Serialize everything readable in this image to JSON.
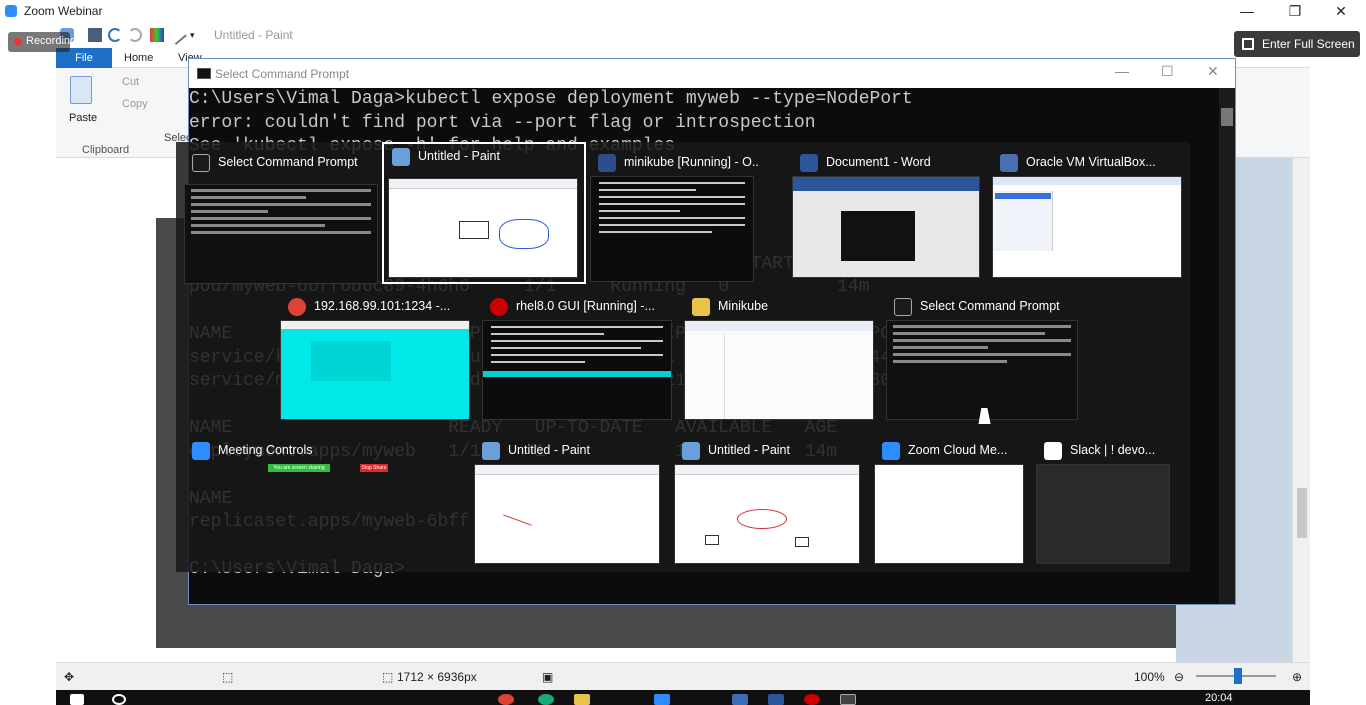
{
  "zoom": {
    "title": "Zoom Webinar",
    "recording_label": "Recording",
    "fullscreen_label": "Enter Full Screen",
    "minimize": "—",
    "maximize": "❐",
    "close": "✕"
  },
  "paint": {
    "title": "Untitled - Paint",
    "tabs": {
      "file": "File",
      "home": "Home",
      "view": "View"
    },
    "ribbon": {
      "paste": "Paste",
      "cut": "Cut",
      "copy": "Copy",
      "clipboard_group": "Clipboard",
      "select": "Selec"
    },
    "status": {
      "dimensions": "1712 × 6936px",
      "zoom": "100%"
    }
  },
  "cmd": {
    "title": "Select Command Prompt",
    "lines": [
      "C:\\Users\\Vimal Daga>kubectl expose deployment myweb --type=NodePort",
      "error: couldn't find port via --port flag or introspection",
      "See 'kubectl expose -h' for help and examples",
      "",
      "",
      "",
      "",
      "NAME                           READY   STATUS    RESTARTS   AGE",
      "pod/myweb-6bff6b6c89-4h6h6     1/1     Running   0          14m",
      "",
      "NAME                    TYPE        CLUSTER-IP   EXTERNAL-IP   PORT(S)   AGE",
      "service/kubernetes      ClusterIP   10.96.0.1    <none>        443/TCP   8m",
      "service/myweb           NodePort    10.96.7.21   <none>        80:3      5",
      "",
      "NAME                    READY   UP-TO-DATE   AVAILABLE   AGE",
      "deployment.apps/myweb   1/1     1            1           14m",
      "",
      "NAME",
      "replicaset.apps/myweb-6bff",
      "",
      "C:\\Users\\Vimal Daga>"
    ]
  },
  "switcher": {
    "row1": [
      {
        "title": "Select Command Prompt",
        "icon": "cmd-icon",
        "icon_color": "#1b1b1b"
      },
      {
        "title": "Untitled - Paint",
        "icon": "paint-icon",
        "icon_color": "#6a9fd8"
      },
      {
        "title": "minikube [Running] - O...",
        "icon": "virtualbox-icon",
        "icon_color": "#2f4d8a"
      },
      {
        "title": "Document1 - Word",
        "icon": "word-icon",
        "icon_color": "#2b579a"
      },
      {
        "title": "Oracle VM VirtualBox...",
        "icon": "virtualbox-icon",
        "icon_color": "#4a6fb0"
      }
    ],
    "row2": [
      {
        "title": "192.168.99.101:1234 -...",
        "icon": "chrome-icon",
        "icon_color": "#db4437"
      },
      {
        "title": "rhel8.0 GUI [Running] -...",
        "icon": "redhat-icon",
        "icon_color": "#cc0000"
      },
      {
        "title": "Minikube",
        "icon": "folder-icon",
        "icon_color": "#e8c34a"
      },
      {
        "title": "Select Command Prompt",
        "icon": "cmd-icon",
        "icon_color": "#1b1b1b"
      }
    ],
    "row3": [
      {
        "title": "Meeting Controls",
        "icon": "zoom-icon",
        "icon_color": "#2d8cff",
        "banner": "You are screen sharing",
        "stop": "Stop Share"
      },
      {
        "title": "Untitled - Paint",
        "icon": "paint-icon",
        "icon_color": "#6a9fd8"
      },
      {
        "title": "Untitled - Paint",
        "icon": "paint-icon",
        "icon_color": "#6a9fd8"
      },
      {
        "title": "Zoom Cloud Me...",
        "icon": "zoom-icon",
        "icon_color": "#2d8cff"
      },
      {
        "title": "Slack | ! devo...",
        "icon": "slack-icon",
        "icon_color": "#4a154b"
      }
    ]
  },
  "taskbar": {
    "time": "20:04"
  },
  "colors": {
    "zoom_blue": "#2d8cff",
    "paint_file_blue": "#1e6fc7",
    "cmd_bg": "#0c0c0c",
    "cmd_text": "#c8c8c8"
  }
}
